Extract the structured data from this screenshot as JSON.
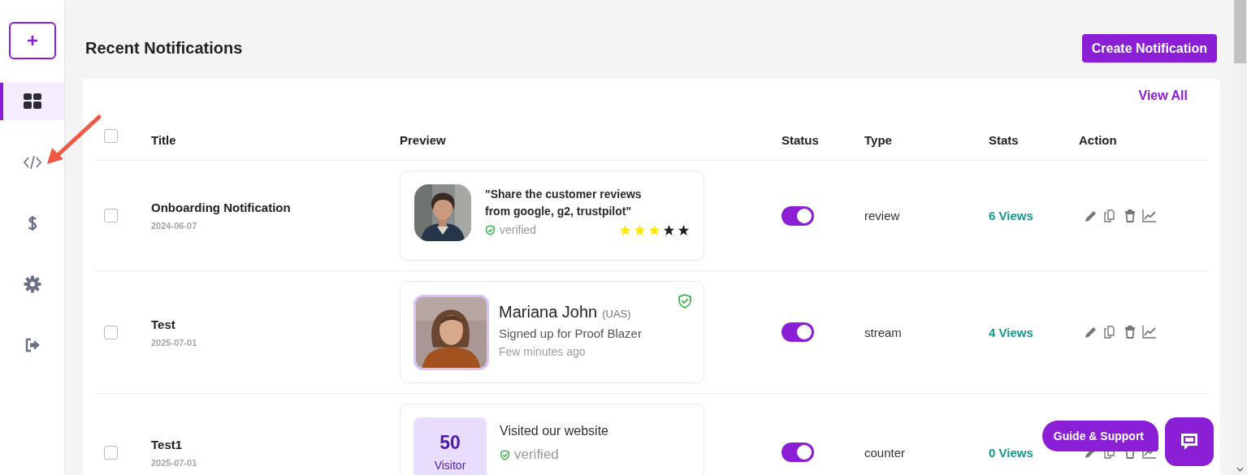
{
  "sidebar": {
    "items": [
      {
        "kind": "dashboard",
        "selected": true
      },
      {
        "kind": "code",
        "selected": false
      },
      {
        "kind": "billing",
        "selected": false
      },
      {
        "kind": "settings",
        "selected": false
      },
      {
        "kind": "logout",
        "selected": false
      }
    ]
  },
  "header": {
    "title": "Recent Notifications",
    "create_button": "Create Notification"
  },
  "table": {
    "view_all": "View All",
    "select_all": {
      "checked": false
    },
    "columns": [
      "Title",
      "Preview",
      "Status",
      "Type",
      "Stats",
      "Action"
    ],
    "rows": [
      {
        "checked": false,
        "title": "Onboarding Notification",
        "date": "2024-06-07",
        "preview": {
          "kind": "review",
          "quote": "\"Share the customer reviews from google, g2, trustpilot\"",
          "verified": "verified",
          "stars": 3
        },
        "on": true,
        "type": "review",
        "stats": "6 Views"
      },
      {
        "checked": false,
        "title": "Test",
        "date": "2025-07-01",
        "preview": {
          "kind": "stream",
          "name": "Mariana John",
          "location": "(UAS)",
          "message": "Signed up for Proof Blazer",
          "time": "Few minutes ago"
        },
        "on": true,
        "type": "stream",
        "stats": "4 Views"
      },
      {
        "checked": false,
        "title": "Test1",
        "date": "2025-07-01",
        "preview": {
          "kind": "counter",
          "count": "50",
          "unit": "Visitor",
          "message": "Visited our website",
          "verified": "verified"
        },
        "on": true,
        "type": "counter",
        "stats": "0 Views"
      }
    ]
  },
  "support": {
    "label": "Guide & Support"
  }
}
